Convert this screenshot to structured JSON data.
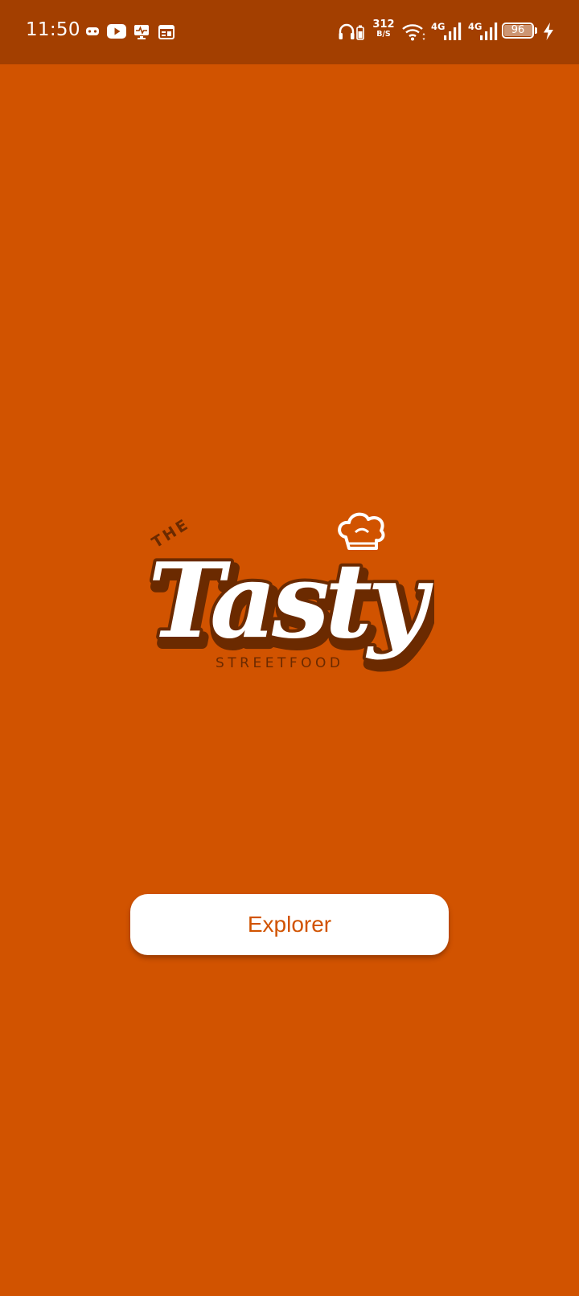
{
  "status_bar": {
    "time": "11:50",
    "net_speed_value": "312",
    "net_speed_unit": "B/S",
    "network_1": "4G",
    "network_2": "4G",
    "battery_level": "96",
    "battery_fraction": 0.96,
    "charging": true,
    "notification_icons": [
      "game-controller-icon",
      "youtube-icon",
      "activity-monitor-icon",
      "calendar-icon"
    ]
  },
  "logo": {
    "top_text": "THE",
    "main_text": "Tasty",
    "sub_text": "STREETFOOD"
  },
  "colors": {
    "background": "#D15300",
    "status_bar": "#A33F00",
    "logo_outline": "#6B2A00",
    "button_bg": "#FFFFFF",
    "button_text": "#D15300"
  },
  "main": {
    "explore_button_label": "Explorer"
  }
}
